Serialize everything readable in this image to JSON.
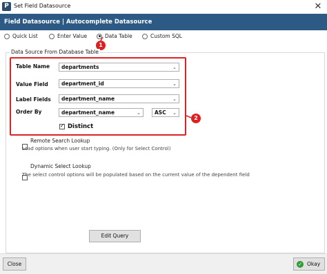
{
  "window": {
    "icon_letter": "P",
    "title": "Set Field Datasource",
    "close_glyph": "✕"
  },
  "header": {
    "title": "Field Datasource | Autocomplete Datasource"
  },
  "source_options": [
    {
      "label": "Quick List",
      "checked": false
    },
    {
      "label": "Enter Value",
      "checked": false
    },
    {
      "label": "Data Table",
      "checked": true
    },
    {
      "label": "Custom SQL",
      "checked": false
    }
  ],
  "callouts": {
    "one": "1",
    "two": "2"
  },
  "group": {
    "label": "Data Source From Database Table"
  },
  "form": {
    "table_name_label": "Table Name",
    "table_name_value": "departments",
    "value_field_label": "Value Field",
    "value_field_value": "department_id",
    "label_fields_label": "Label Fields",
    "label_fields_value": "department_name",
    "order_by_label": "Order By",
    "order_by_value": "department_name",
    "order_dir_value": "ASC",
    "distinct_label": "Distinct",
    "distinct_checked": true
  },
  "remote_search": {
    "label": "Remote Search Lookup",
    "description": "Load options when user start typing. (Only for Select Control)",
    "checked": false
  },
  "dynamic_select": {
    "label": "Dynamic Select Lookup",
    "description": "The select control options will be populated based on the current value of the dependent field",
    "checked": false
  },
  "buttons": {
    "edit_query": "Edit Query",
    "close": "Close",
    "okay": "Okay"
  },
  "colors": {
    "header_bg": "#2d5a85",
    "callout_red": "#e02020",
    "okay_icon_green": "#3a9a3a"
  }
}
